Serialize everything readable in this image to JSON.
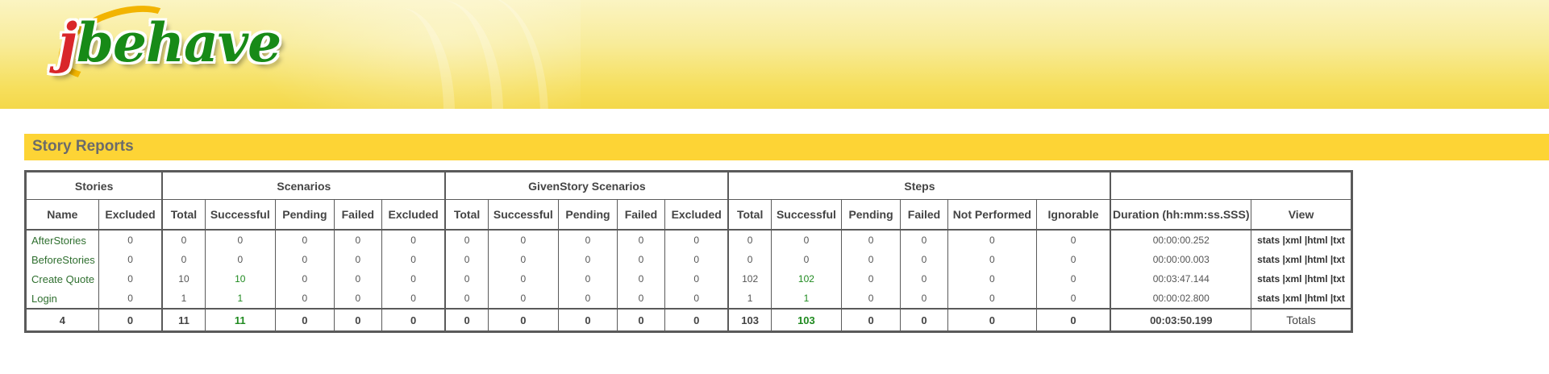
{
  "logo": {
    "j": "j",
    "rest": "behave"
  },
  "section": {
    "title": "Story Reports"
  },
  "groups": {
    "stories": "Stories",
    "scenarios": "Scenarios",
    "given": "GivenStory Scenarios",
    "steps": "Steps"
  },
  "columns": {
    "name": "Name",
    "excluded": "Excluded",
    "sc_total": "Total",
    "sc_successful": "Successful",
    "sc_pending": "Pending",
    "sc_failed": "Failed",
    "sc_excluded": "Excluded",
    "gs_total": "Total",
    "gs_successful": "Successful",
    "gs_pending": "Pending",
    "gs_failed": "Failed",
    "gs_excluded": "Excluded",
    "st_total": "Total",
    "st_successful": "Successful",
    "st_pending": "Pending",
    "st_failed": "Failed",
    "st_not_performed": "Not Performed",
    "st_ignorable": "Ignorable",
    "duration": "Duration (hh:mm:ss.SSS)",
    "view": "View"
  },
  "view_links": {
    "stats": "stats",
    "xml": "|xml",
    "html": "|html",
    "txt": "|txt"
  },
  "rows": [
    {
      "name": "AfterStories",
      "cells": [
        "0",
        "0",
        "0",
        "0",
        "0",
        "0",
        "0",
        "0",
        "0",
        "0",
        "0",
        "0",
        "0",
        "0",
        "0",
        "0",
        "0"
      ],
      "duration": "00:00:00.252"
    },
    {
      "name": "BeforeStories",
      "cells": [
        "0",
        "0",
        "0",
        "0",
        "0",
        "0",
        "0",
        "0",
        "0",
        "0",
        "0",
        "0",
        "0",
        "0",
        "0",
        "0",
        "0"
      ],
      "duration": "00:00:00.003"
    },
    {
      "name": "Create Quote",
      "cells": [
        "0",
        "10",
        "10",
        "0",
        "0",
        "0",
        "0",
        "0",
        "0",
        "0",
        "0",
        "102",
        "102",
        "0",
        "0",
        "0",
        "0"
      ],
      "duration": "00:03:47.144"
    },
    {
      "name": "Login",
      "cells": [
        "0",
        "1",
        "1",
        "0",
        "0",
        "0",
        "0",
        "0",
        "0",
        "0",
        "0",
        "1",
        "1",
        "0",
        "0",
        "0",
        "0"
      ],
      "duration": "00:00:02.800"
    }
  ],
  "totals": {
    "name": "4",
    "cells": [
      "0",
      "11",
      "11",
      "0",
      "0",
      "0",
      "0",
      "0",
      "0",
      "0",
      "0",
      "103",
      "103",
      "0",
      "0",
      "0",
      "0"
    ],
    "duration": "00:03:50.199",
    "label": "Totals"
  }
}
